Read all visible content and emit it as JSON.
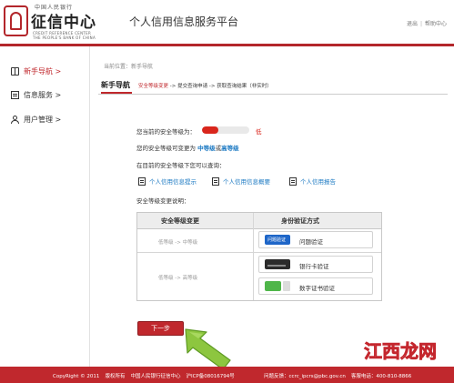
{
  "header": {
    "logo_small": "中国人民银行",
    "logo_text": "征信中心",
    "logo_en_line1": "CREDIT REFERENCE CENTER",
    "logo_en_line2": "THE PEOPLE'S BANK OF CHINA",
    "platform_title": "个人信用信息服务平台",
    "logout": "退出",
    "help": "帮助中心",
    "accent_color": "#b3262b"
  },
  "sidebar": {
    "items": [
      {
        "label": "新手导航 >",
        "icon": "book-icon",
        "active": true
      },
      {
        "label": "信息服务 >",
        "icon": "document-icon",
        "active": false
      },
      {
        "label": "用户管理 >",
        "icon": "user-icon",
        "active": false
      }
    ]
  },
  "breadcrumb": "当前位置：新手导航",
  "page": {
    "heading": "新手导航",
    "steps_current": "安全等级变更",
    "steps_rest": "-> 提交查询申请 -> 获取查询结果（非实时）"
  },
  "security": {
    "current_label": "您当前的安全等级为：",
    "current_value": "低",
    "level_fraction": 0.35,
    "change_prefix": "您的安全等级可变更为",
    "change_option_1": "中等级",
    "change_or": "或",
    "change_option_2": "高等级",
    "can_query_label": "在目前的安全等级下您可以查询：",
    "explain_label": "安全等级变更说明："
  },
  "query_links": [
    {
      "label": "个人信用信息提示",
      "icon": "notice-icon"
    },
    {
      "label": "个人信用信息概要",
      "icon": "summary-icon"
    },
    {
      "label": "个人信用报告",
      "icon": "report-icon"
    }
  ],
  "table": {
    "col_change": "安全等级变更",
    "col_method": "身份验证方式",
    "row1_change": "低等级 -> 中等级",
    "row2_change": "低等级 -> 高等级",
    "question_icon_text": "问题验证",
    "method_question": "问题验证",
    "method_bankcard": "银行卡验证",
    "method_cert": "数字证书验证"
  },
  "next_button": "下一步",
  "footer": {
    "copyright": "CopyRight © 2011",
    "rights": "版权所有",
    "org": "中国人民银行征信中心",
    "icp": "沪ICP备08016794号",
    "feedback": "问题反馈：ccrc_ipcrs@pbc.gov.cn",
    "hotline": "客服电话：400-810-8866"
  },
  "watermark": {
    "text": "江西龙网"
  }
}
